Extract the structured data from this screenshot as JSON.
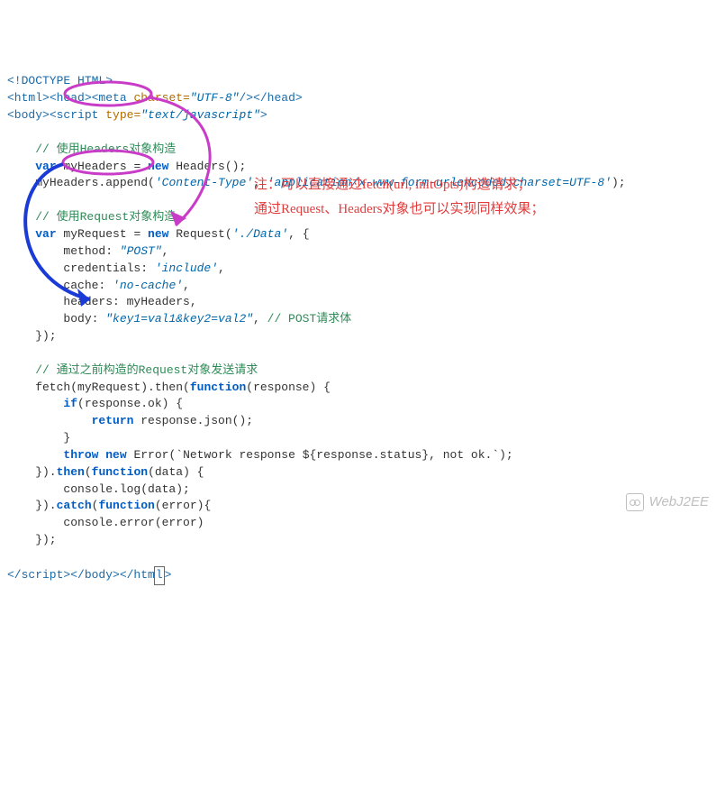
{
  "code": {
    "line1_a": "<!DOCTYPE HTML>",
    "line2_open_html": "<html>",
    "line2_open_head": "<head>",
    "line2_meta_open": "<meta ",
    "line2_meta_attr": "charset=",
    "line2_meta_val": "\"UTF-8\"",
    "line2_meta_close": "/>",
    "line2_close_head": "</head>",
    "line3_open_body": "<body>",
    "line3_script_open": "<script ",
    "line3_script_attr": "type=",
    "line3_script_val": "\"text/javascript\"",
    "line3_script_close": ">",
    "cmt1": "// 使用Headers对象构造",
    "l_var": "var",
    "l_new": "new",
    "l_func": "function",
    "l_if": "if",
    "l_return": "return",
    "l_throw": "throw",
    "l_catch": "catch",
    "l_then": "then",
    "myHeaders_decl_a": " myHeaders = ",
    "myHeaders_decl_b": " Headers();",
    "append_a": "myHeaders.append(",
    "append_s1": "'Content-Type'",
    "append_c": ", ",
    "append_s2": "'application/x-www-form-urlencoded;charset=UTF-8'",
    "append_end": ");",
    "cmt2": "// 使用Request对象构造",
    "req_a": " myRequest = ",
    "req_b": " Request(",
    "req_url": "'./Data'",
    "req_c": ", {",
    "opt_method_k": "        method: ",
    "opt_method_v": "\"POST\"",
    "comma": ",",
    "opt_cred_k": "        credentials: ",
    "opt_cred_v": "'include'",
    "opt_cache_k": "        cache: ",
    "opt_cache_v": "'no-cache'",
    "opt_headers": "        headers: myHeaders,",
    "opt_body_k": "        body: ",
    "opt_body_v": "\"key1=val1&key2=val2\"",
    "opt_body_c": ", ",
    "opt_body_cmt": "// POST请求体",
    "close_req": "    });",
    "cmt3": "// 通过之前构造的Request对象发送请求",
    "fetch_a": "    fetch(myRequest).then(",
    "fetch_b": "(response) {",
    "if_a": "        ",
    "if_b": "(response.ok) {",
    "ret_a": "            ",
    "ret_b": " response.json();",
    "closeb": "        }",
    "throw_a": "        ",
    "throw_b": " ",
    "throw_c": " Error(`Network response ${response.status}, not ok.`);",
    "then2_a": "    }).",
    "then2_b": "(",
    "then2_c": "(data) {",
    "log": "        console.log(data);",
    "catch_a": "    }).",
    "catch_b": "(",
    "catch_c": "(error){",
    "err": "        console.error(error)",
    "close_fn": "    });",
    "close_script": "</script>",
    "close_body": "</body>",
    "close_html_a": "</htm",
    "close_html_cursor": "l",
    "close_html_b": ">"
  },
  "annotation": {
    "line1": "注：可以直接通过fetch(url, initOpts)构造请求；",
    "line2": "通过Request、Headers对象也可以实现同样效果；"
  },
  "watermark": "WebJ2EE"
}
